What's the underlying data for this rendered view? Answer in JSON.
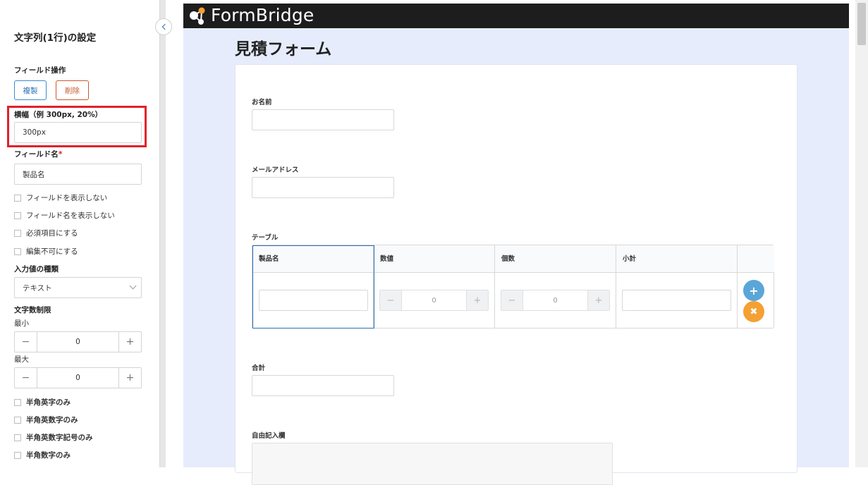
{
  "panel": {
    "title": "文字列(1行)の設定",
    "field_ops_label": "フィールド操作",
    "copy_label": "複製",
    "delete_label": "削除",
    "width_label": "横幅（例 300px, 20%）",
    "width_value": "300px",
    "field_name_label": "フィールド名",
    "required_mark": "*",
    "field_name_value": "製品名",
    "checkboxes": [
      "フィールドを表示しない",
      "フィールド名を表示しない",
      "必須項目にする",
      "編集不可にする"
    ],
    "input_type_label": "入力値の種類",
    "input_type_value": "テキスト",
    "char_limit_label": "文字数制限",
    "min_label": "最小",
    "min_value": "0",
    "max_label": "最大",
    "max_value": "0",
    "stepper_minus": "−",
    "stepper_plus": "+",
    "restrictions": [
      "半角英字のみ",
      "半角英数字のみ",
      "半角英数字記号のみ",
      "半角数字のみ"
    ]
  },
  "preview": {
    "brand": "FormBridge",
    "form_title": "見積フォーム",
    "fields": {
      "name_label": "お名前",
      "email_label": "メールアドレス",
      "table_label": "テーブル",
      "total_label": "合計",
      "free_label": "自由記入欄"
    },
    "table": {
      "headers": [
        "製品名",
        "数値",
        "個数",
        "小計"
      ],
      "number_value": "0",
      "count_value": "0",
      "add_icon": "+",
      "remove_icon": "✖"
    }
  },
  "colors": {
    "accent": "#2a6fb5",
    "highlight": "#e2202a",
    "preview_bg": "#e6ecfb",
    "add_button": "#5aa6d8",
    "remove_button": "#f5a033"
  }
}
